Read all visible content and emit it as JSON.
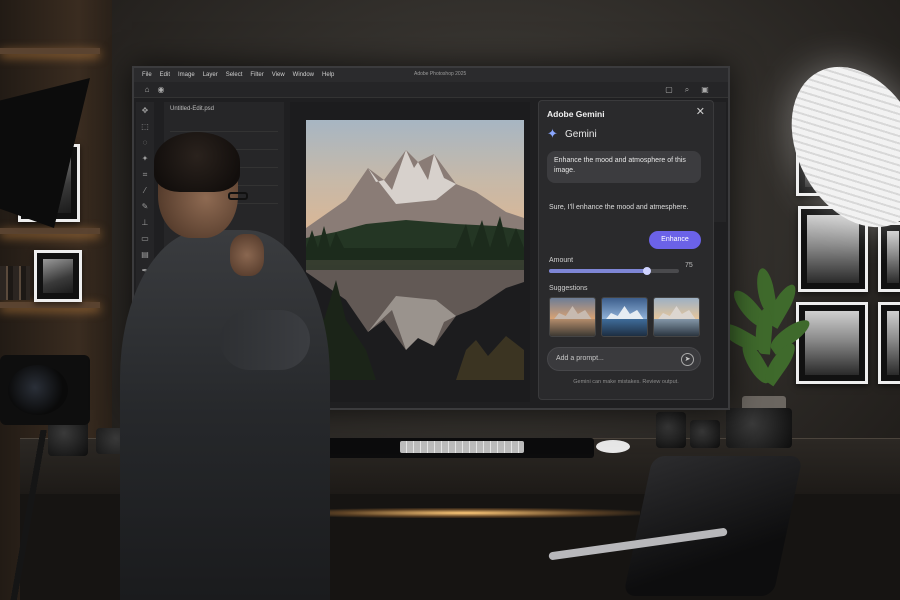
{
  "scene": {
    "description_type": "photo of photographer studio with large monitor"
  },
  "monitor": {
    "menu": [
      "File",
      "Edit",
      "Image",
      "Layer",
      "Select",
      "Filter",
      "View",
      "Window",
      "Help"
    ],
    "app_title": "Adobe Photoshop 2025",
    "layers_file": "Untitled-Edit.psd"
  },
  "panel": {
    "header": "Adobe Gemini",
    "close": "✕",
    "brand": "Gemini",
    "user_message": "Enhance the mood and atmosphere of this image.",
    "assistant_reply": "Sure, I'll enhance the mood and atmesphere.",
    "enhance_button": "Enhance",
    "amount_label": "Amount",
    "amount_value": "75",
    "amount_fraction": 0.75,
    "suggestions_label": "Suggestions",
    "prompt_placeholder": "Add a prompt...",
    "disclaimer": "Gemini can make mistakes. Review output."
  },
  "colors": {
    "accent": "#6b62e8",
    "panel_bg": "#2a2a2c"
  }
}
